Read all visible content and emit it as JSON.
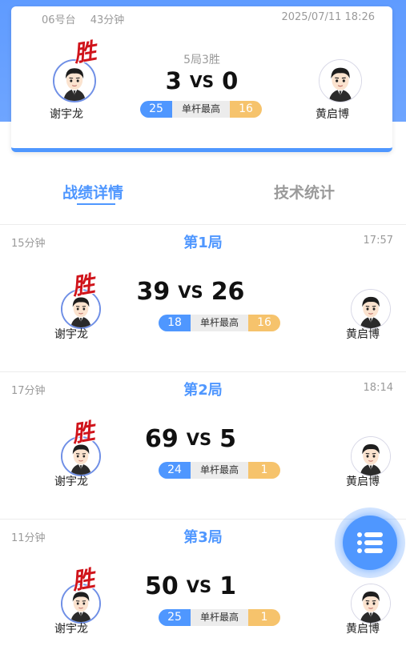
{
  "summary": {
    "table": "06号台",
    "duration": "43分钟",
    "datetime": "2025/07/11 18:26",
    "result_text": "5局3胜",
    "score_left": "3",
    "vs": "VS",
    "score_right": "0",
    "player_left": "谢宇龙",
    "player_right": "黄启博",
    "win_badge": "胜",
    "highest_left": "25",
    "highest_label": "单杆最高",
    "highest_right": "16"
  },
  "tabs": [
    {
      "label": "战绩详情",
      "active": true
    },
    {
      "label": "技术统计",
      "active": false
    }
  ],
  "frames": [
    {
      "duration": "15分钟",
      "title": "第1局",
      "time": "17:57",
      "score_left": "39",
      "vs": "VS",
      "score_right": "26",
      "player_left": "谢宇龙",
      "player_right": "黄启博",
      "win_badge": "胜",
      "highest_left": "18",
      "highest_label": "单杆最高",
      "highest_right": "16"
    },
    {
      "duration": "17分钟",
      "title": "第2局",
      "time": "18:14",
      "score_left": "69",
      "vs": "VS",
      "score_right": "5",
      "player_left": "谢宇龙",
      "player_right": "黄启博",
      "win_badge": "胜",
      "highest_left": "24",
      "highest_label": "单杆最高",
      "highest_right": "1"
    },
    {
      "duration": "11分钟",
      "title": "第3局",
      "time": "",
      "score_left": "50",
      "vs": "VS",
      "score_right": "1",
      "player_left": "谢宇龙",
      "player_right": "黄启博",
      "win_badge": "胜",
      "highest_left": "25",
      "highest_label": "单杆最高",
      "highest_right": "1"
    }
  ],
  "icons": {
    "menu": "list-menu-icon",
    "avatar": "cartoon-man-avatar"
  },
  "colors": {
    "accent": "#4f97ff",
    "highlight": "#f6c36c",
    "win": "#d0141b"
  }
}
